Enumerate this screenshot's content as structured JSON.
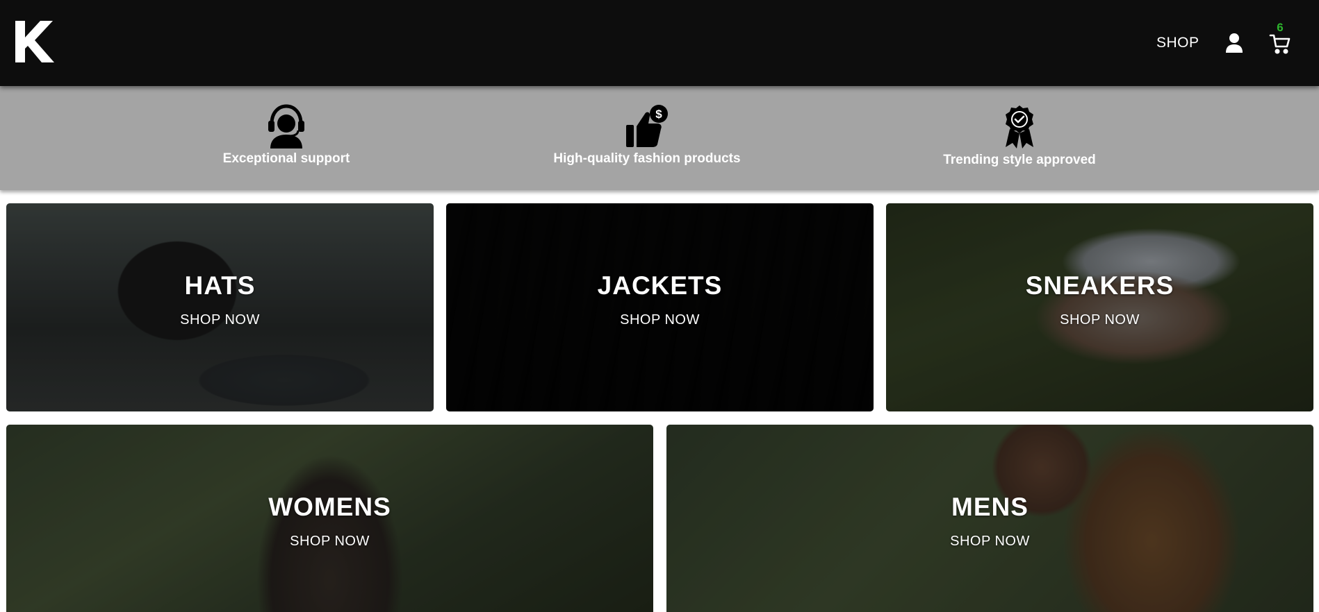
{
  "header": {
    "logo_icon": "k-logo-icon",
    "nav_shop_label": "SHOP",
    "user_icon": "user-icon",
    "cart_icon": "cart-icon",
    "cart_count": "6",
    "cart_count_color": "#2db52d"
  },
  "features": [
    {
      "icon": "headset-support-icon",
      "label": "Exceptional support"
    },
    {
      "icon": "thumbs-up-dollar-icon",
      "label": "High-quality fashion products"
    },
    {
      "icon": "award-ribbon-icon",
      "label": "Trending style approved"
    }
  ],
  "categories": [
    {
      "title": "HATS",
      "cta": "SHOP NOW"
    },
    {
      "title": "JACKETS",
      "cta": "SHOP NOW"
    },
    {
      "title": "SNEAKERS",
      "cta": "SHOP NOW"
    },
    {
      "title": "WOMENS",
      "cta": "SHOP NOW"
    },
    {
      "title": "MENS",
      "cta": "SHOP NOW"
    }
  ],
  "colors": {
    "header_bg": "#0d0d0d",
    "features_bg": "#a4a4a4",
    "text_light": "#ffffff"
  }
}
